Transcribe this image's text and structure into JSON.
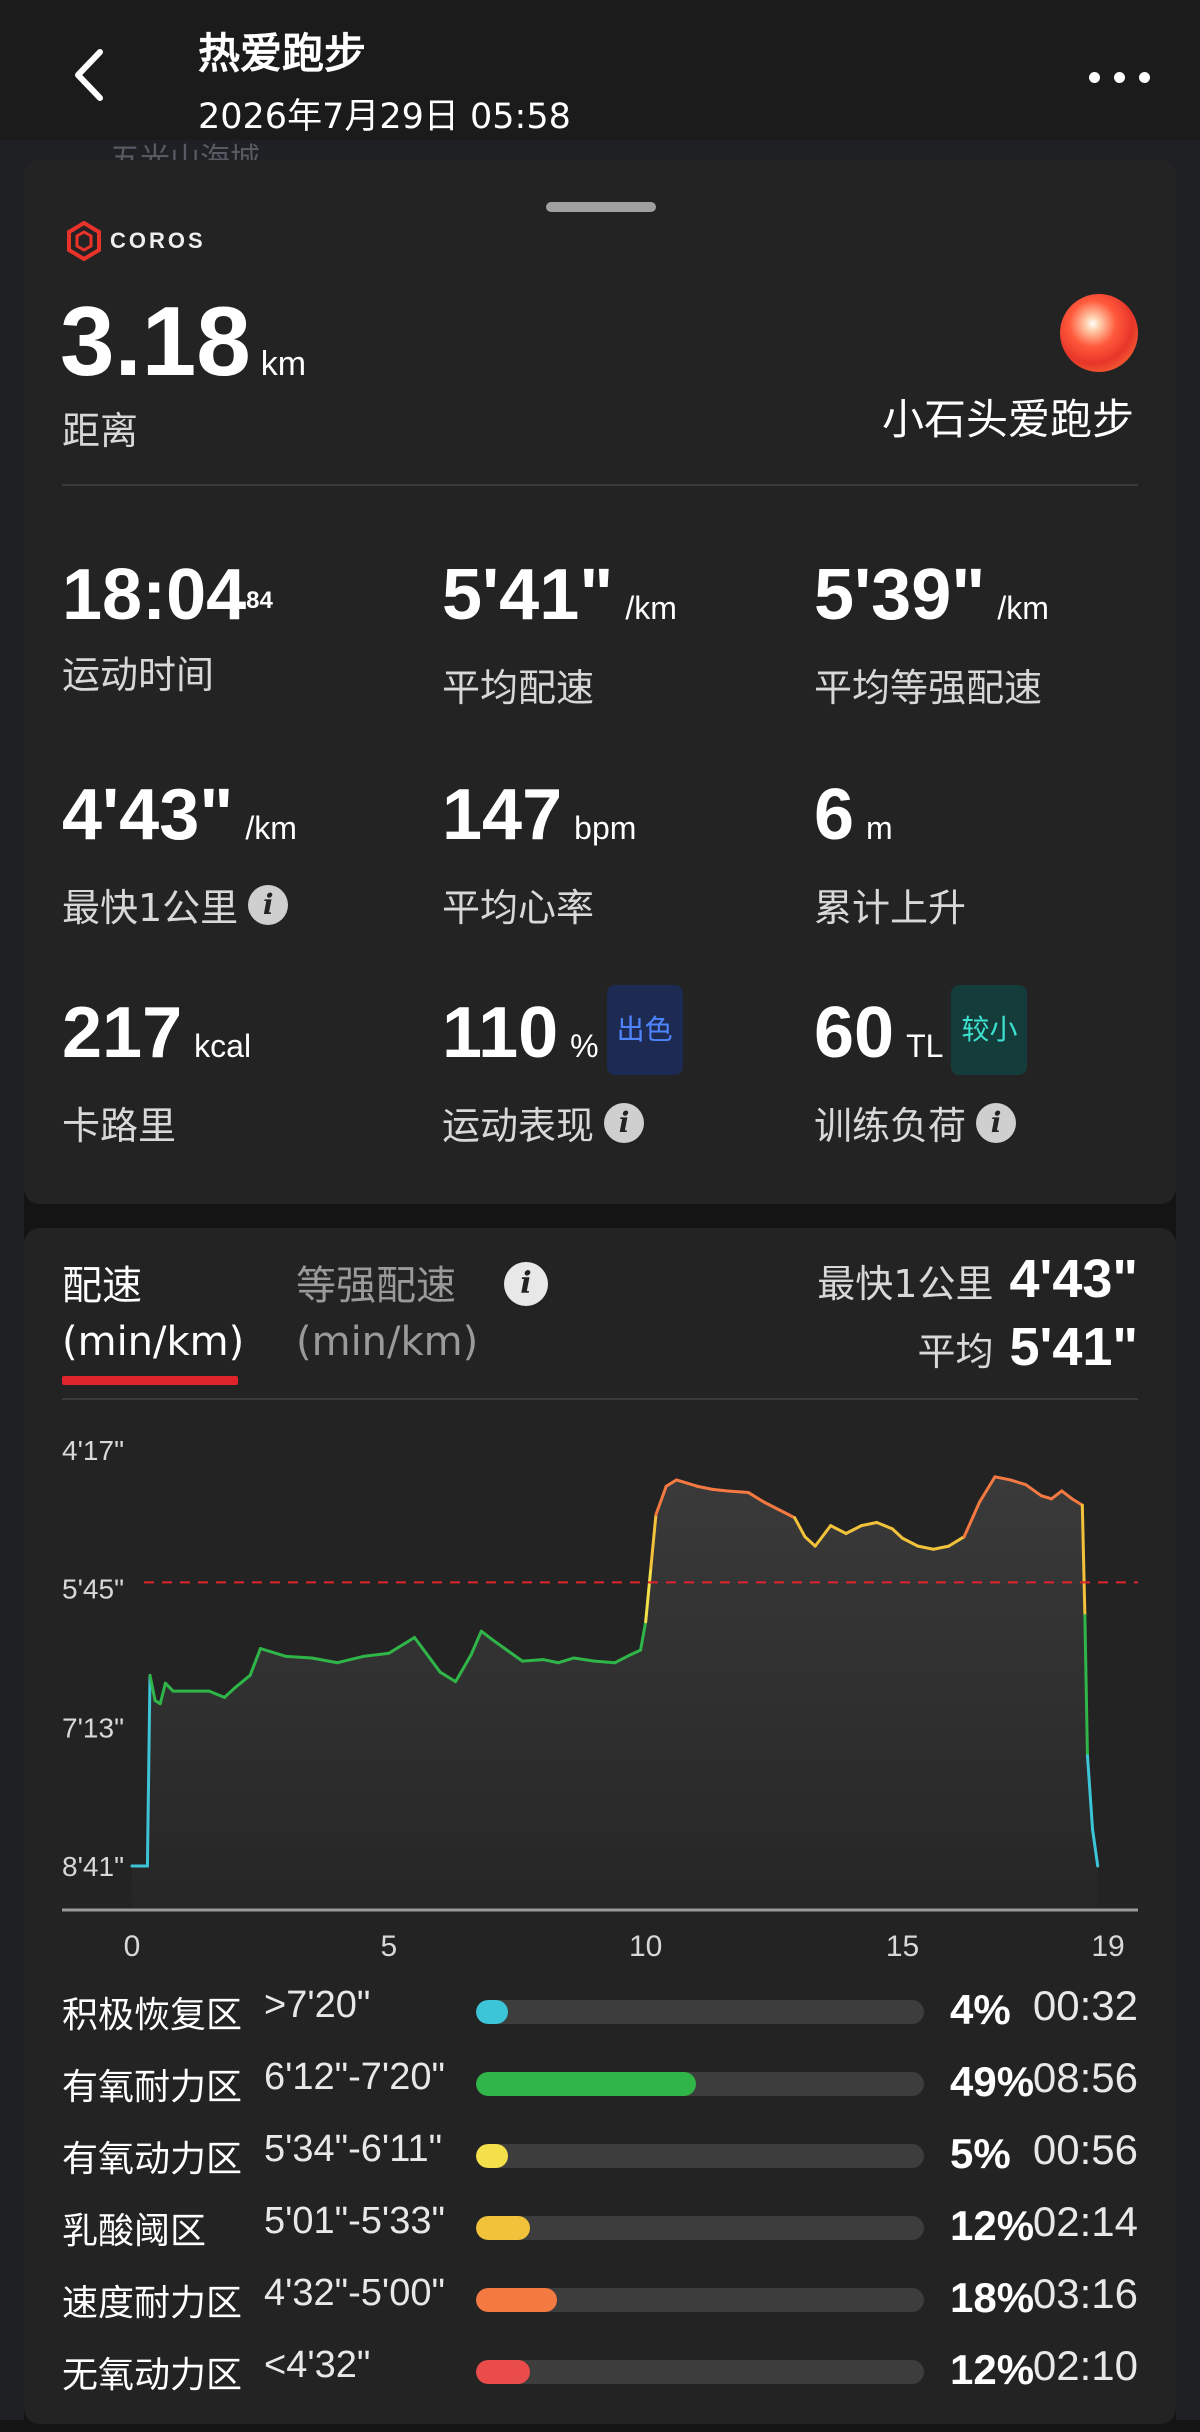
{
  "header": {
    "title": "热爱跑步",
    "datetime": "2026年7月29日 05:58"
  },
  "map_hint": "五光山海城",
  "summary": {
    "brand": "COROS",
    "distance_value": "3.18",
    "distance_unit": "km",
    "distance_label": "距离",
    "username": "小石头爱跑步",
    "stats": [
      {
        "value": "18:04",
        "sup": "84",
        "unit": "",
        "label": "运动时间"
      },
      {
        "value": "5'41\"",
        "unit": "/km",
        "label": "平均配速"
      },
      {
        "value": "5'39\"",
        "unit": "/km",
        "label": "平均等强配速"
      },
      {
        "value": "4'43\"",
        "unit": "/km",
        "label": "最快1公里",
        "info": true
      },
      {
        "value": "147",
        "unit": "bpm",
        "label": "平均心率"
      },
      {
        "value": "6",
        "unit": "m",
        "label": "累计上升"
      },
      {
        "value": "217",
        "unit": "kcal",
        "label": "卡路里"
      },
      {
        "value": "110",
        "unit": "%",
        "badge": "出色",
        "label": "运动表现",
        "info": true
      },
      {
        "value": "60",
        "unit": "TL",
        "badge": "较小",
        "label": "训练负荷",
        "info": true
      }
    ]
  },
  "pace_panel": {
    "tab_active_line1": "配速",
    "tab_active_line2": "(min/km)",
    "tab_other_line1": "等强配速",
    "tab_other_line2": "(min/km)",
    "fastest_label": "最快1公里",
    "fastest_value": "4'43\"",
    "avg_label": "平均",
    "avg_value": "5'41\""
  },
  "chart_data": {
    "type": "area",
    "title": "",
    "xlabel": "",
    "ylabel": "配速 (min/km)",
    "y_inverted": true,
    "y_ticks": [
      "4'17\"",
      "5'45\"",
      "7'13\"",
      "8'41\""
    ],
    "y_tick_seconds": [
      257,
      345,
      433,
      521
    ],
    "x_ticks": [
      "0",
      "5",
      "10",
      "15",
      "19"
    ],
    "xlim": [
      0,
      19
    ],
    "ylim_seconds": [
      257,
      521
    ],
    "avg_line_seconds": 341,
    "x": [
      0,
      0.3,
      0.35,
      0.45,
      0.55,
      0.65,
      0.8,
      1,
      1.5,
      1.8,
      2,
      2.3,
      2.5,
      3,
      3.5,
      4,
      4.5,
      5,
      5.5,
      6,
      6.3,
      6.6,
      6.8,
      7,
      7.3,
      7.6,
      8,
      8.3,
      8.6,
      9,
      9.4,
      9.7,
      9.9,
      10,
      10.1,
      10.2,
      10.4,
      10.6,
      10.8,
      11,
      11.3,
      11.6,
      12,
      12.3,
      12.6,
      12.9,
      13.1,
      13.3,
      13.6,
      13.9,
      14.2,
      14.5,
      14.8,
      15,
      15.3,
      15.6,
      15.9,
      16.2,
      16.5,
      16.8,
      17.1,
      17.4,
      17.7,
      17.9,
      18.1,
      18.3,
      18.5,
      18.55,
      18.6,
      18.7,
      18.8
    ],
    "pace_seconds": [
      521,
      521,
      400,
      416,
      418,
      405,
      410,
      410,
      410,
      414,
      408,
      400,
      383,
      388,
      389,
      392,
      388,
      386,
      376,
      398,
      404,
      387,
      372,
      377,
      384,
      391,
      390,
      392,
      389,
      391,
      392,
      387,
      384,
      366,
      332,
      298,
      280,
      276,
      278,
      280,
      282,
      283,
      284,
      290,
      295,
      300,
      312,
      318,
      305,
      310,
      305,
      303,
      307,
      313,
      318,
      320,
      318,
      312,
      290,
      274,
      276,
      279,
      286,
      288,
      283,
      288,
      292,
      362,
      451,
      498,
      521
    ],
    "pace_zones_seconds": [
      440,
      372,
      334,
      301,
      272
    ]
  },
  "zones": [
    {
      "name": "积极恢复区",
      "range": ">7'20\"",
      "percent": 4,
      "percent_label": "4%",
      "time": "00:32",
      "color": "#3cc4d8"
    },
    {
      "name": "有氧耐力区",
      "range": "6'12\"-7'20\"",
      "percent": 49,
      "percent_label": "49%",
      "time": "08:56",
      "color": "#2fb548"
    },
    {
      "name": "有氧动力区",
      "range": "5'34\"-6'11\"",
      "percent": 5,
      "percent_label": "5%",
      "time": "00:56",
      "color": "#f3e04a"
    },
    {
      "name": "乳酸阈区",
      "range": "5'01\"-5'33\"",
      "percent": 12,
      "percent_label": "12%",
      "time": "02:14",
      "color": "#f2c23b"
    },
    {
      "name": "速度耐力区",
      "range": "4'32\"-5'00\"",
      "percent": 18,
      "percent_label": "18%",
      "time": "03:16",
      "color": "#f47a42"
    },
    {
      "name": "无氧动力区",
      "range": "<4'32\"",
      "percent": 12,
      "percent_label": "12%",
      "time": "02:10",
      "color": "#ea4b4b"
    }
  ]
}
